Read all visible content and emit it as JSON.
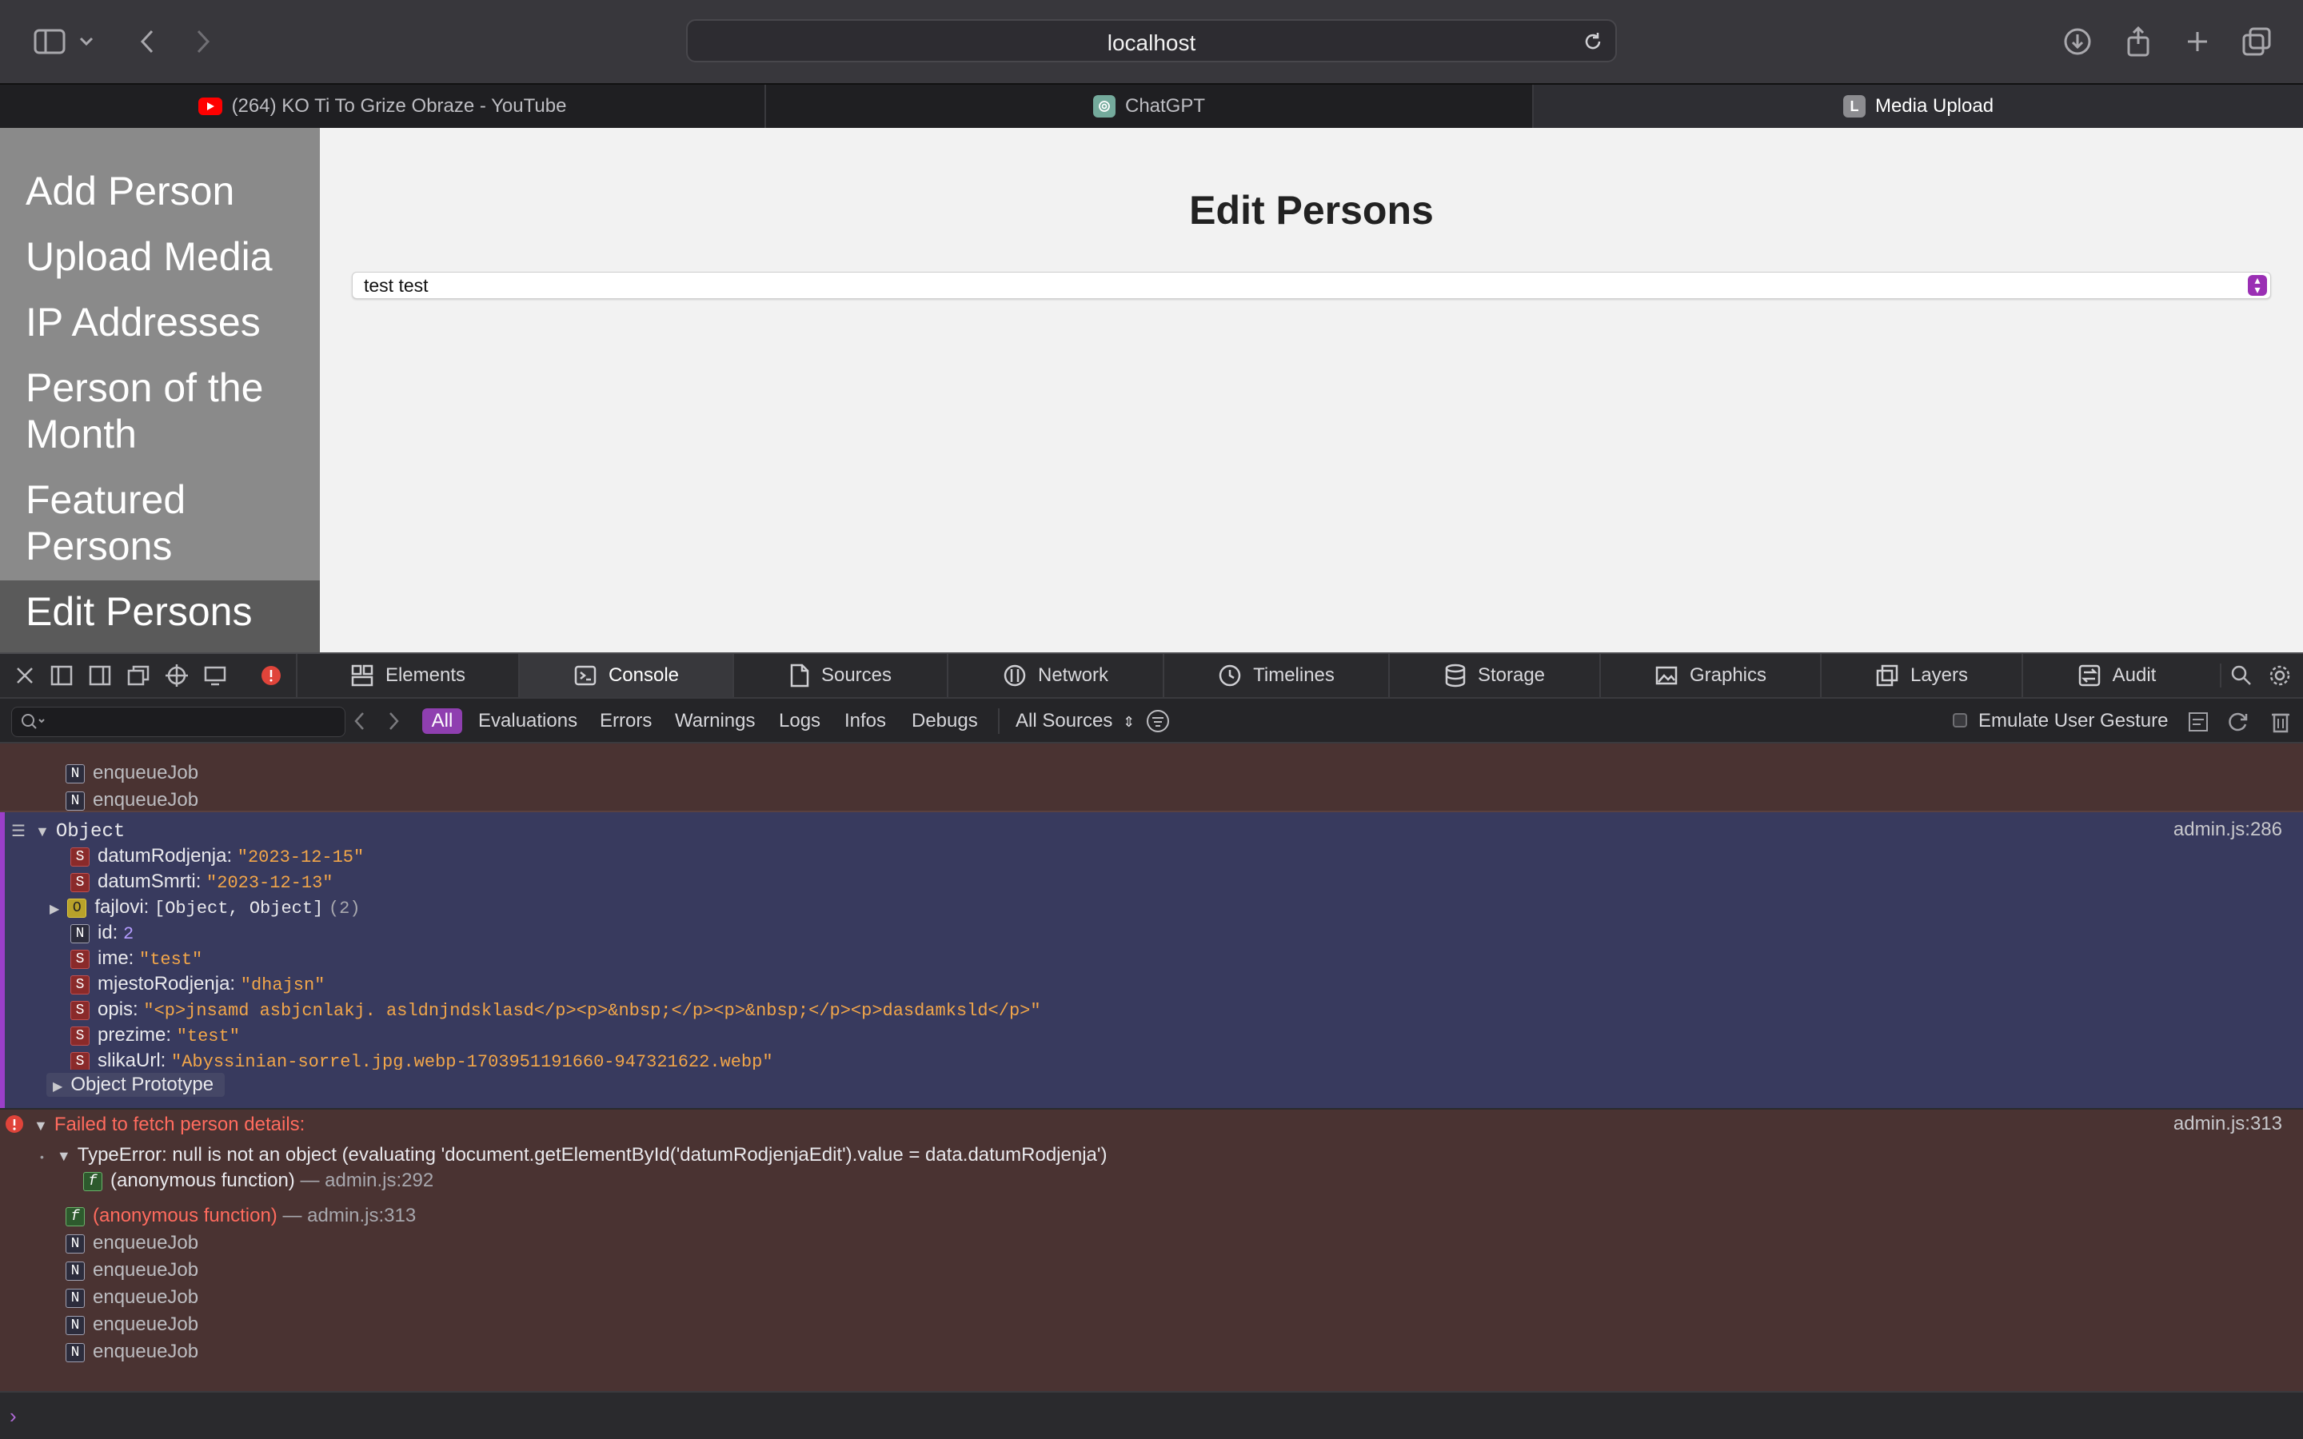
{
  "browser": {
    "address": "localhost",
    "tabs": [
      {
        "label": "(264) KO Ti To Grize Obraze - YouTube",
        "favicon": "youtube-icon",
        "color": "#ff0000"
      },
      {
        "label": "ChatGPT",
        "favicon": "chatgpt-icon",
        "color": "#74aa9c"
      },
      {
        "label": "Media Upload",
        "favicon_letter": "L",
        "active": true
      }
    ]
  },
  "sidebar": {
    "items": [
      {
        "label": "Add Person"
      },
      {
        "label": "Upload Media"
      },
      {
        "label": "IP Addresses"
      },
      {
        "label": "Person of the Month"
      },
      {
        "label": "Featured Persons"
      },
      {
        "label": "Edit Persons",
        "active": true
      }
    ]
  },
  "main": {
    "title": "Edit Persons",
    "person_select_value": "test test"
  },
  "devtools": {
    "tabs": [
      {
        "label": "Elements"
      },
      {
        "label": "Console",
        "active": true
      },
      {
        "label": "Sources"
      },
      {
        "label": "Network"
      },
      {
        "label": "Timelines"
      },
      {
        "label": "Storage"
      },
      {
        "label": "Graphics"
      },
      {
        "label": "Layers"
      },
      {
        "label": "Audit"
      }
    ],
    "filters": {
      "all": "All",
      "evaluations": "Evaluations",
      "errors": "Errors",
      "warnings": "Warnings",
      "logs": "Logs",
      "infos": "Infos",
      "debugs": "Debugs",
      "sources": "All Sources",
      "emulate": "Emulate User Gesture"
    },
    "colors": {
      "accent": "#8f3fb0",
      "error_bg": "#4a3332",
      "object_bg": "#383a5e"
    }
  },
  "console": {
    "top_frames": [
      "enqueueJob",
      "enqueueJob"
    ],
    "object": {
      "label": "Object",
      "source": "admin.js:286",
      "props": [
        {
          "type": "S",
          "key": "datumRodjenja:",
          "value": "\"2023-12-15\""
        },
        {
          "type": "S",
          "key": "datumSmrti:",
          "value": "\"2023-12-13\""
        },
        {
          "type": "O",
          "key": "fajlovi:",
          "value": "[Object, Object]",
          "extra": "(2)"
        },
        {
          "type": "N",
          "key": "id:",
          "value": "2"
        },
        {
          "type": "S",
          "key": "ime:",
          "value": "\"test\""
        },
        {
          "type": "S",
          "key": "mjestoRodjenja:",
          "value": "\"dhajsn\""
        },
        {
          "type": "S",
          "key": "opis:",
          "value": "\"<p>jnsamd asbjcnlakj. asldnjndsklasd</p><p>&nbsp;</p><p>&nbsp;</p><p>dasdamksld</p>\""
        },
        {
          "type": "S",
          "key": "prezime:",
          "value": "\"test\""
        },
        {
          "type": "S",
          "key": "slikaUrl:",
          "value": "\"Abyssinian-sorrel.jpg.webp-1703951191660-947321622.webp\""
        }
      ],
      "prototype": "Object Prototype"
    },
    "error": {
      "message": "Failed to fetch person details:",
      "source": "admin.js:313",
      "type_error": "TypeError: null is not an object (evaluating 'document.getElementById('datumRodjenjaEdit').value = data.datumRodjenja')",
      "inner_frame": "(anonymous function)",
      "inner_frame_src": "— admin.js:292",
      "outer_frame": "(anonymous function)",
      "outer_frame_src": "— admin.js:313",
      "frames": [
        "enqueueJob",
        "enqueueJob",
        "enqueueJob",
        "enqueueJob",
        "enqueueJob"
      ]
    }
  }
}
